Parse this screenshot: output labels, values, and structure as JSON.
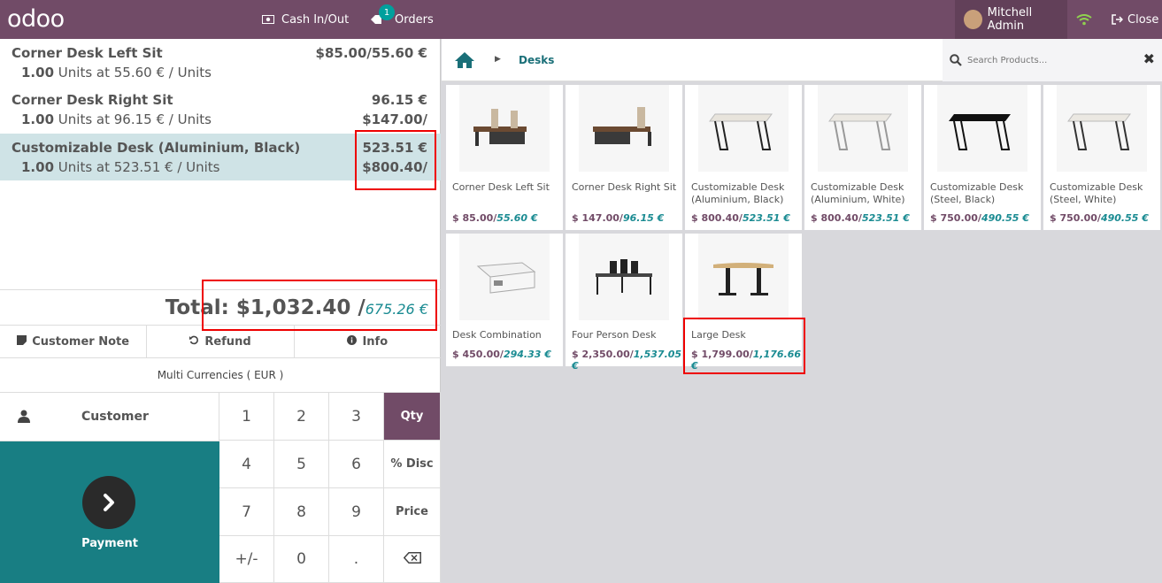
{
  "topbar": {
    "logo": "odoo",
    "cash_label": "Cash In/Out",
    "orders_label": "Orders",
    "orders_badge": "1",
    "user_name": "Mitchell Admin",
    "close_label": "Close"
  },
  "orderlines": [
    {
      "name": "Corner Desk Left Sit",
      "price": "$85.00/55.60 €",
      "qty": "1.00",
      "unit_text": "Units at 55.60 € / Units",
      "price2": ""
    },
    {
      "name": "Corner Desk Right Sit",
      "price": "96.15 €",
      "qty": "1.00",
      "unit_text": "Units at 96.15 € / Units",
      "price2": "$147.00/"
    },
    {
      "name": "Customizable Desk (Aluminium, Black)",
      "price": "523.51 €",
      "qty": "1.00",
      "unit_text": "Units at 523.51 € / Units",
      "price2": "$800.40/"
    }
  ],
  "total": {
    "label": "Total: $1,032.40 /",
    "eur": "675.26 €"
  },
  "actions": {
    "customer_note": "Customer Note",
    "refund": "Refund",
    "info": "Info"
  },
  "multi_currency": "Multi Currencies ( EUR )",
  "customer_label": "Customer",
  "payment_label": "Payment",
  "numpad": [
    "1",
    "2",
    "3",
    "Qty",
    "4",
    "5",
    "6",
    "% Disc",
    "7",
    "8",
    "9",
    "Price",
    "+/-",
    "0",
    "."
  ],
  "breadcrumb": {
    "category": "Desks"
  },
  "search": {
    "placeholder": "Search Products..."
  },
  "products": [
    {
      "name": "Corner Desk Left Sit",
      "usd": "$ 85.00/",
      "eur": "55.60 €"
    },
    {
      "name": "Corner Desk Right Sit",
      "usd": "$ 147.00/",
      "eur": "96.15 €"
    },
    {
      "name": "Customizable Desk (Aluminium, Black)",
      "usd": "$ 800.40/",
      "eur": "523.51 €"
    },
    {
      "name": "Customizable Desk (Aluminium, White)",
      "usd": "$ 800.40/",
      "eur": "523.51 €"
    },
    {
      "name": "Customizable Desk (Steel, Black)",
      "usd": "$ 750.00/",
      "eur": "490.55 €"
    },
    {
      "name": "Customizable Desk (Steel, White)",
      "usd": "$ 750.00/",
      "eur": "490.55 €"
    },
    {
      "name": "Desk Combination",
      "usd": "$ 450.00/",
      "eur": "294.33 €"
    },
    {
      "name": "Four Person Desk",
      "usd": "$ 2,350.00/",
      "eur": "1,537.05 €"
    },
    {
      "name": "Large Desk",
      "usd": "$ 1,799.00/",
      "eur": "1,176.66 €"
    }
  ],
  "colors": {
    "brand": "#714b67",
    "teal": "#187e83",
    "eur_text": "#1a8b92",
    "highlight": "#e00000"
  }
}
